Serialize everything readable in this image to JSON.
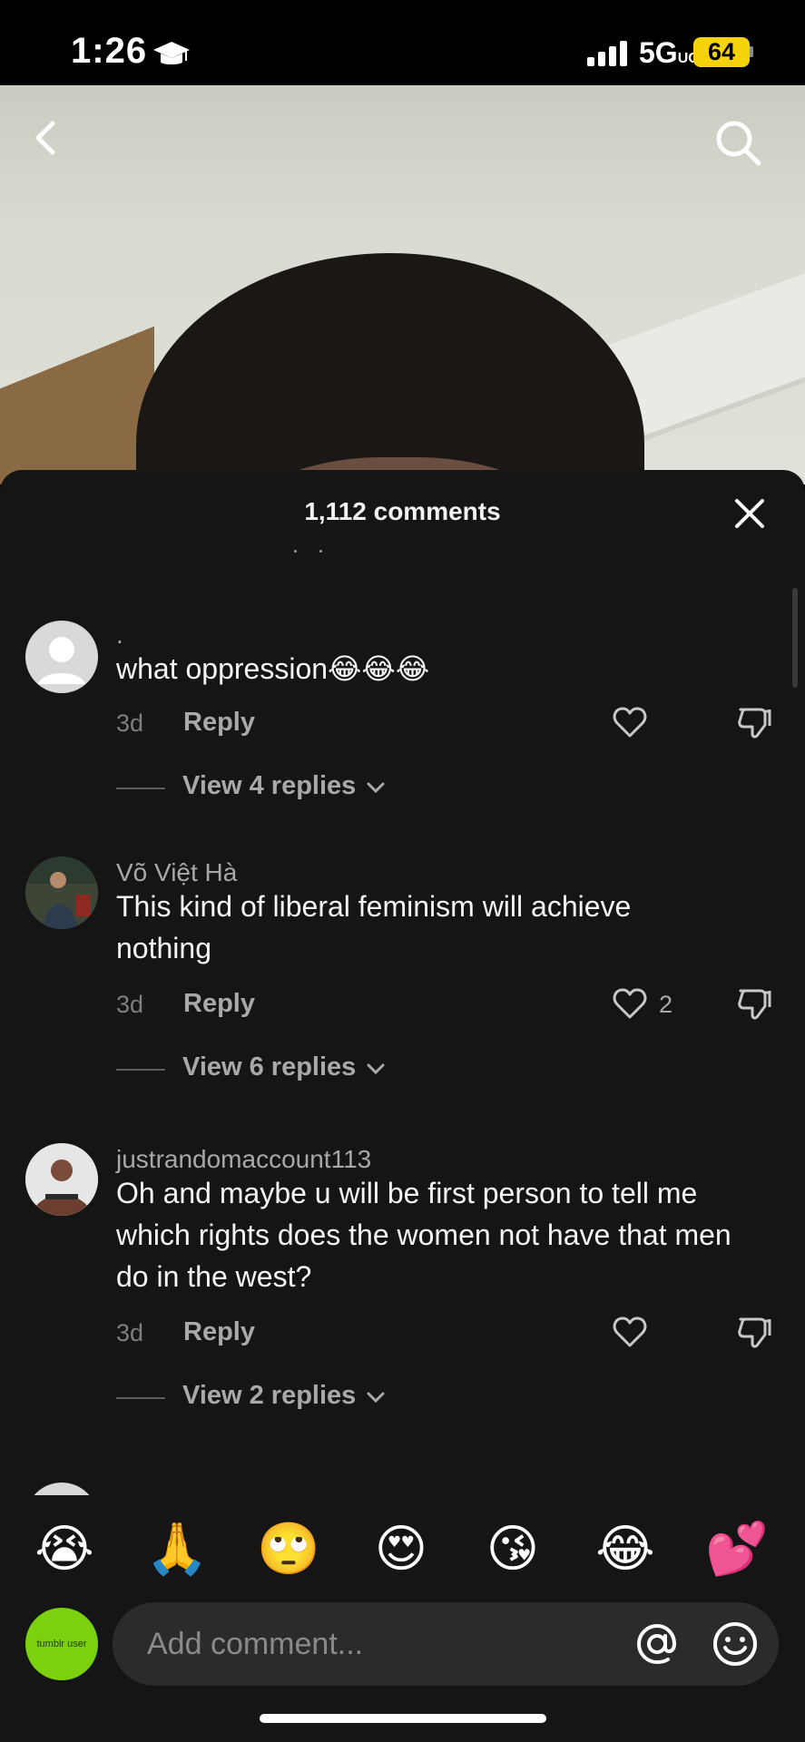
{
  "status_bar": {
    "time": "1:26",
    "network": "5G",
    "network_suffix": "UC",
    "battery": "64",
    "icons": [
      "graduation-cap-icon",
      "signal-icon",
      "battery-icon"
    ]
  },
  "video": {
    "icons": [
      "back-icon",
      "search-icon"
    ]
  },
  "sheet": {
    "title": "1,112 comments",
    "close_icon": "close-icon"
  },
  "comments": [
    {
      "username": ".",
      "text": "what oppression😂😂😂",
      "time": "3d",
      "reply_label": "Reply",
      "likes": "",
      "view_replies": "View 4 replies"
    },
    {
      "username": "Võ Việt Hà",
      "text": "This kind of liberal feminism will achieve nothing",
      "time": "3d",
      "reply_label": "Reply",
      "likes": "2",
      "view_replies": "View 6 replies"
    },
    {
      "username": "justrandomaccount113",
      "text": "Oh and maybe u will be first person to tell me which rights does the women not have that men do in the west?",
      "time": "3d",
      "reply_label": "Reply",
      "likes": "",
      "view_replies": "View 2 replies"
    }
  ],
  "emoji_bar": [
    "😭",
    "🙏",
    "🙄",
    "😍",
    "😘",
    "😂",
    "💕"
  ],
  "composer": {
    "avatar_label": "tumblr user",
    "placeholder": "Add comment...",
    "icons": [
      "at-icon",
      "emoji-icon"
    ]
  },
  "colors": {
    "sheet_bg": "#151515",
    "input_bg": "#2b2b2b",
    "battery": "#f5d20a",
    "avatar_green": "#7bd10e"
  }
}
